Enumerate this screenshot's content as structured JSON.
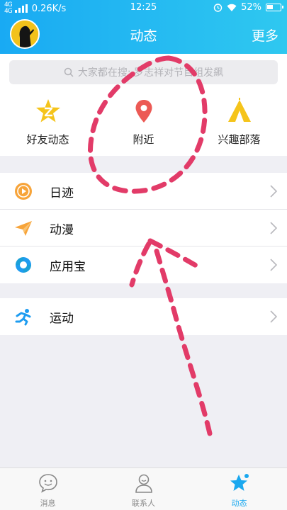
{
  "status_bar": {
    "network_speed": "0.26K/s",
    "time": "12:25",
    "battery": "52%"
  },
  "header": {
    "title": "动态",
    "more": "更多"
  },
  "search": {
    "placeholder": "大家都在搜: 罗志祥对节目组发飙"
  },
  "quick_items": [
    {
      "label": "好友动态",
      "icon": "star-z-icon",
      "color": "#f5c41b"
    },
    {
      "label": "附近",
      "icon": "location-pin-icon",
      "color": "#ec5a55"
    },
    {
      "label": "兴趣部落",
      "icon": "tent-icon",
      "color": "#f5c41b"
    }
  ],
  "list_group_1": [
    {
      "label": "日迹",
      "icon": "video-circle-icon"
    },
    {
      "label": "动漫",
      "icon": "paper-plane-icon"
    },
    {
      "label": "应用宝",
      "icon": "app-store-icon"
    }
  ],
  "list_group_2": [
    {
      "label": "运动",
      "icon": "running-icon"
    }
  ],
  "tabs": [
    {
      "label": "消息",
      "icon": "chat-bubble-icon"
    },
    {
      "label": "联系人",
      "icon": "contacts-icon"
    },
    {
      "label": "动态",
      "icon": "star-icon",
      "active": true
    }
  ],
  "colors": {
    "accent": "#1aa8ef",
    "annotation": "#e23b68"
  }
}
